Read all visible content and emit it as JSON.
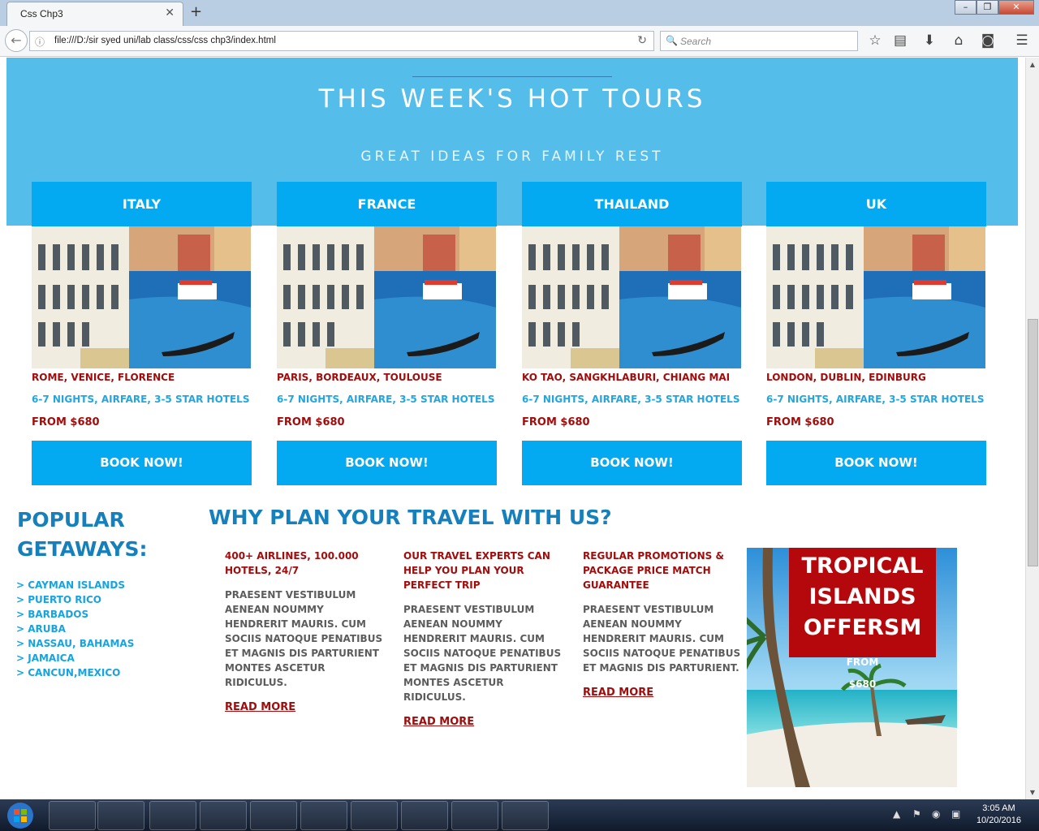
{
  "browser": {
    "tab_title": "Css Chp3",
    "url": "file:///D:/sir syed uni/lab class/css/css chp3/index.html",
    "search_placeholder": "Search",
    "icons": [
      "back-arrow-icon",
      "info-icon",
      "reload-icon",
      "search-icon",
      "bookmark-star-icon",
      "reading-list-icon",
      "download-icon",
      "home-icon",
      "pocket-icon",
      "menu-icon"
    ]
  },
  "hero": {
    "title": "THIS WEEK'S HOT TOURS",
    "subtitle": "GREAT IDEAS FOR FAMILY REST",
    "bg_color": "#55bdea"
  },
  "tours": [
    {
      "country": "ITALY",
      "cities": "ROME, VENICE, FLORENCE",
      "details": "6-7 NIGHTS, AIRFARE, 3-5 STAR HOTELS",
      "price": "FROM $680",
      "button": "BOOK NOW!"
    },
    {
      "country": "FRANCE",
      "cities": "PARIS, BORDEAUX, TOULOUSE",
      "details": "6-7 NIGHTS, AIRFARE, 3-5 STAR HOTELS",
      "price": "FROM $680",
      "button": "BOOK NOW!"
    },
    {
      "country": "THAILAND",
      "cities": "KO TAO, SANGKHLABURI, CHIANG MAI",
      "details": "6-7 NIGHTS, AIRFARE, 3-5 STAR HOTELS",
      "price": "FROM $680",
      "button": "BOOK NOW!"
    },
    {
      "country": "UK",
      "cities": "LONDON, DUBLIN, EDINBURG",
      "details": "6-7 NIGHTS, AIRFARE, 3-5 STAR HOTELS",
      "price": "FROM $680",
      "button": "BOOK NOW!"
    }
  ],
  "popular": {
    "title": "POPULAR GETAWAYS:",
    "items": [
      "> CAYMAN ISLANDS",
      "> PUERTO RICO",
      "> BARBADOS",
      "> ARUBA",
      "> NASSAU, BAHAMAS",
      "> JAMAICA",
      "> CANCUN,MEXICO"
    ]
  },
  "why": {
    "title": "WHY PLAN YOUR TRAVEL WITH US?",
    "columns": [
      {
        "heading": "400+ AIRLINES, 100.000 HOTELS, 24/7",
        "body": "PRAESENT VESTIBULUM AENEAN NOUMMY HENDRERIT MAURIS. CUM SOCIIS NATOQUE PENATIBUS ET MAGNIS DIS PARTURIENT MONTES ASCETUR RIDICULUS.",
        "link": "READ MORE"
      },
      {
        "heading": "OUR TRAVEL EXPERTS CAN HELP YOU PLAN YOUR PERFECT TRIP",
        "body": "PRAESENT VESTIBULUM AENEAN NOUMMY HENDRERIT MAURIS. CUM SOCIIS NATOQUE PENATIBUS ET MAGNIS DIS PARTURIENT MONTES ASCETUR RIDICULUS.",
        "link": "READ MORE"
      },
      {
        "heading": "REGULAR PROMOTIONS & PACKAGE PRICE MATCH GUARANTEE",
        "body": "PRAESENT VESTIBULUM AENEAN NOUMMY HENDRERIT MAURIS. CUM SOCIIS NATOQUE PENATIBUS ET MAGNIS DIS PARTURIENT.",
        "link": "READ MORE"
      }
    ]
  },
  "promo": {
    "line1": "TROPICAL",
    "line2": "ISLANDS",
    "line3": "OFFERSM",
    "from": "FROM",
    "price": "$680"
  },
  "taskbar": {
    "time": "3:05 AM",
    "date": "10/20/2016",
    "apps": [
      "winrar-icon",
      "media-player-icon",
      "file-explorer-icon",
      "utorrent-icon",
      "skype-icon",
      "internet-explorer-icon",
      "notepad-icon",
      "firefox-icon",
      "chrome-icon",
      "photoshop-icon"
    ]
  },
  "colors": {
    "accent": "#03a9f1",
    "heading_blue": "#1680bc",
    "dark_red": "#a10c0c"
  }
}
